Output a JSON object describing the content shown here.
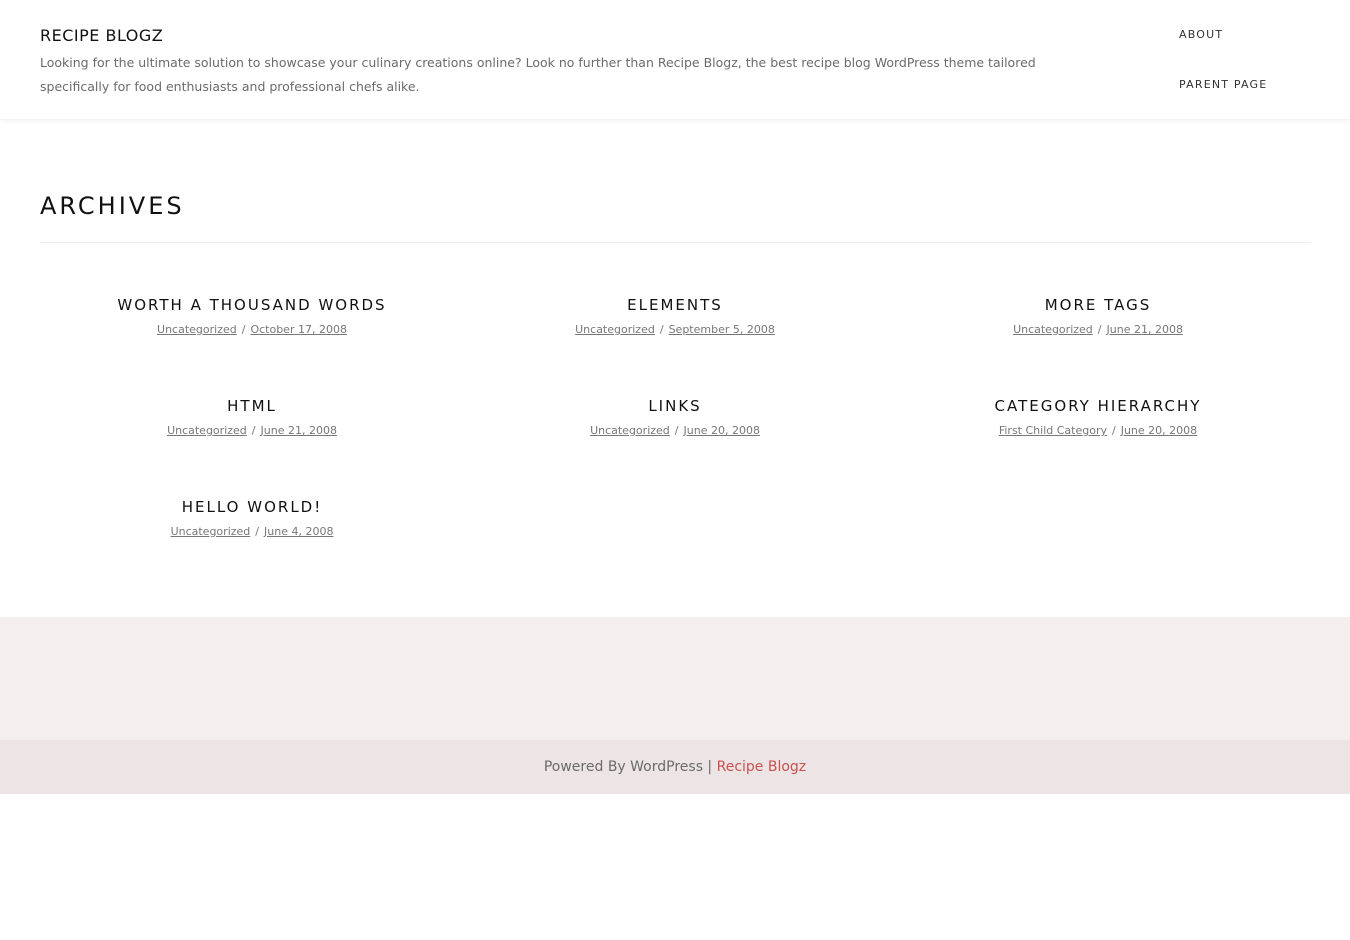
{
  "header": {
    "site_title": "RECIPE BLOGZ",
    "site_description": "Looking for the ultimate solution to showcase your culinary creations online? Look no further than Recipe Blogz, the best recipe blog WordPress theme tailored specifically for food enthusiasts and professional chefs alike.",
    "nav": [
      {
        "label": "ABOUT"
      },
      {
        "label": "PARENT PAGE"
      }
    ]
  },
  "main": {
    "page_title": "ARCHIVES",
    "meta_separator": "/",
    "posts": [
      {
        "title": "WORTH A THOUSAND WORDS",
        "category": "Uncategorized",
        "date": "October 17, 2008"
      },
      {
        "title": "ELEMENTS",
        "category": "Uncategorized",
        "date": "September 5, 2008"
      },
      {
        "title": "MORE TAGS",
        "category": "Uncategorized",
        "date": "June 21, 2008"
      },
      {
        "title": "HTML",
        "category": "Uncategorized",
        "date": "June 21, 2008"
      },
      {
        "title": "LINKS",
        "category": "Uncategorized",
        "date": "June 20, 2008"
      },
      {
        "title": "CATEGORY HIERARCHY",
        "category": "First Child Category",
        "date": "June 20, 2008"
      },
      {
        "title": "HELLO WORLD!",
        "category": "Uncategorized",
        "date": "June 4, 2008"
      }
    ]
  },
  "footer": {
    "powered_text": "Powered By WordPress | ",
    "brand_link": "Recipe Blogz"
  },
  "colors": {
    "accent": "#c9514e",
    "footer_band": "#f5eeee",
    "footer_bar": "#ede4e5"
  }
}
